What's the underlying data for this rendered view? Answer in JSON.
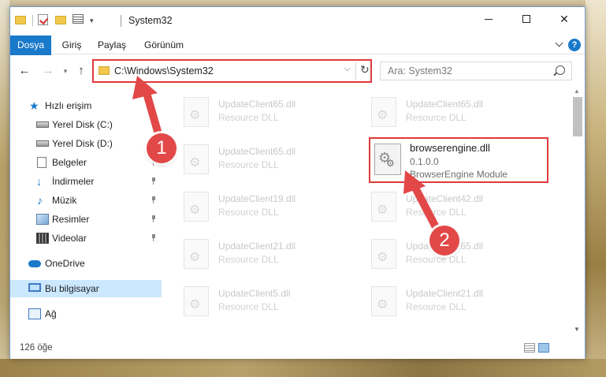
{
  "window": {
    "title": "System32"
  },
  "ribbon": {
    "tabs": [
      "Dosya",
      "Giriş",
      "Paylaş",
      "Görünüm"
    ],
    "help": "?"
  },
  "navigation": {
    "back": "←",
    "forward": "→",
    "recent": "▾",
    "up": "↑",
    "address": "C:\\Windows\\System32",
    "address_dropdown": "⌵",
    "refresh": "↻",
    "search_placeholder": "Ara: System32"
  },
  "sidebar": {
    "items": [
      {
        "label": "Hızlı erişim",
        "icon": "star-icon"
      },
      {
        "label": "Yerel Disk (C:)",
        "icon": "disk-icon"
      },
      {
        "label": "Yerel Disk (D:)",
        "icon": "disk-icon"
      },
      {
        "label": "Belgeler",
        "icon": "documents-icon"
      },
      {
        "label": "İndirmeler",
        "icon": "download-icon"
      },
      {
        "label": "Müzik",
        "icon": "music-icon"
      },
      {
        "label": "Resimler",
        "icon": "pictures-icon"
      },
      {
        "label": "Videolar",
        "icon": "videos-icon"
      },
      {
        "label": "OneDrive",
        "icon": "cloud-icon"
      },
      {
        "label": "Bu bilgisayar",
        "icon": "computer-icon",
        "selected": true
      },
      {
        "label": "Ağ",
        "icon": "network-icon"
      }
    ]
  },
  "files": [
    {
      "name": "UpdateClient65.dll",
      "type": "Resource DLL"
    },
    {
      "name": "UpdateClient65.dll",
      "type": "Resource DLL"
    },
    {
      "name": "UpdateClient65.dll",
      "type": "Resource DLL"
    },
    {
      "name": "UpdateClient19.dll",
      "type": "Resource DLL"
    },
    {
      "name": "UpdateClient42.dll",
      "type": "Resource DLL"
    },
    {
      "name": "UpdateClient21.dll",
      "type": "Resource DLL"
    },
    {
      "name": "UpdateClient65.dll",
      "type": "Resource DLL"
    },
    {
      "name": "UpdateClient5.dll",
      "type": "Resource DLL"
    },
    {
      "name": "UpdateClient21.dll",
      "type": "Resource DLL"
    }
  ],
  "highlighted_file": {
    "name": "browserengine.dll",
    "version": "0.1.0.0",
    "description": "BrowserEngine Module"
  },
  "status": {
    "count": "126 öğe"
  },
  "annotations": {
    "step1": "1",
    "step2": "2",
    "color": "#e24848"
  }
}
